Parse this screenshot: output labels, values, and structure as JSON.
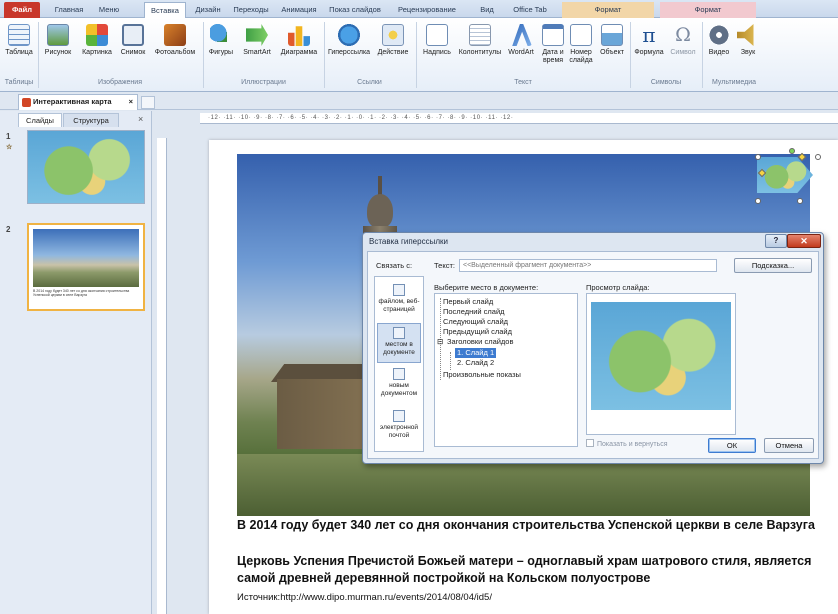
{
  "ribbon_tabs": [
    {
      "label": "Файл"
    },
    {
      "label": "Главная"
    },
    {
      "label": "Меню"
    },
    {
      "label": "Вставка"
    },
    {
      "label": "Дизайн"
    },
    {
      "label": "Переходы"
    },
    {
      "label": "Анимация"
    },
    {
      "label": "Показ слайдов"
    },
    {
      "label": "Рецензирование"
    },
    {
      "label": "Вид"
    },
    {
      "label": "Office Tab"
    },
    {
      "label": "Формат"
    },
    {
      "label": "Формат"
    }
  ],
  "ribbon_buttons": [
    {
      "label": "Таблица",
      "icon": "table-icon"
    },
    {
      "label": "Рисунок",
      "icon": "picture-icon"
    },
    {
      "label": "Картинка",
      "icon": "clipart-icon"
    },
    {
      "label": "Снимок",
      "icon": "screenshot-icon"
    },
    {
      "label": "Фотоальбом",
      "icon": "photo-album-icon"
    },
    {
      "label": "Фигуры",
      "icon": "shapes-icon"
    },
    {
      "label": "SmartArt",
      "icon": "smartart-icon"
    },
    {
      "label": "Диаграмма",
      "icon": "chart-icon"
    },
    {
      "label": "Гиперссылка",
      "icon": "hyperlink-icon"
    },
    {
      "label": "Действие",
      "icon": "action-icon"
    },
    {
      "label": "Надпись",
      "icon": "textbox-icon"
    },
    {
      "label": "Колонтитулы",
      "icon": "header-footer-icon"
    },
    {
      "label": "WordArt",
      "icon": "wordart-icon"
    },
    {
      "label": "Дата и время",
      "icon": "date-time-icon"
    },
    {
      "label": "Номер слайда",
      "icon": "slide-number-icon"
    },
    {
      "label": "Объект",
      "icon": "object-icon"
    },
    {
      "label": "Формула",
      "icon": "equation-icon"
    },
    {
      "label": "Символ",
      "icon": "symbol-icon"
    },
    {
      "label": "Видео",
      "icon": "video-icon"
    },
    {
      "label": "Звук",
      "icon": "audio-icon"
    }
  ],
  "ribbon_groups": [
    {
      "label": "Таблицы"
    },
    {
      "label": "Изображения"
    },
    {
      "label": "Иллюстрации"
    },
    {
      "label": "Ссылки"
    },
    {
      "label": "Текст"
    },
    {
      "label": "Символы"
    },
    {
      "label": "Мультимедиа"
    }
  ],
  "document_tab": {
    "label": "Интерактивная карта",
    "close": "×"
  },
  "left_panel": {
    "tabs": [
      {
        "label": "Слайды"
      },
      {
        "label": "Структура"
      }
    ],
    "close": "×",
    "thumbnails": [
      {
        "number": "1"
      },
      {
        "number": "2"
      }
    ],
    "thumb2_caption": "В 2014 году будет 340 лет со дня окончания строительства Успенской церкви в селе Варзуга"
  },
  "ruler": {
    "horizontal": "·12· ·11· ·10· ·9· ·8· ·7· ·6· ·5· ·4· ·3· ·2· ·1· ·0· ·1· ·2· ·3· ·4· ·5· ·6· ·7· ·8· ·9· ·10· ·11· ·12·"
  },
  "slide": {
    "line1": "В 2014 году будет 340 лет со дня окончания строительства Успенской церкви в селе Варзуга",
    "line2": "Церковь Успения Пречистой Божьей матери – одноглавый храм шатрового стиля, является самой древней деревянной постройкой на Кольском полуострове",
    "source": "Источник:http://www.dipo.murman.ru/events/2014/08/04/id5/"
  },
  "dialog": {
    "title": "Вставка гиперссылки",
    "help": "?",
    "close": "✕",
    "link_to_label": "Связать с:",
    "link_options": [
      {
        "label": "файлом, веб-страницей",
        "icon": "web-page-icon"
      },
      {
        "label": "местом в документе",
        "icon": "place-in-document-icon"
      },
      {
        "label": "новым документом",
        "icon": "new-document-icon"
      },
      {
        "label": "электронной почтой",
        "icon": "email-icon"
      }
    ],
    "text_label": "Текст:",
    "text_value": "<<Выделенный фрагмент документа>>",
    "screentip_button": "Подсказка...",
    "place_label": "Выберите место в документе:",
    "tree": {
      "first": "Первый слайд",
      "last": "Последний слайд",
      "next": "Следующий слайд",
      "prev": "Предыдущий слайд",
      "headers": "Заголовки слайдов",
      "slide1": "1. Слайд 1",
      "slide2": "2. Слайд 2",
      "custom": "Произвольные показы"
    },
    "preview_label": "Просмотр слайда:",
    "show_and_return": "Показать и вернуться",
    "ok": "ОК",
    "cancel": "Отмена"
  },
  "colors": {
    "file_tab": "#c8372b",
    "selection": "#3d7bd0",
    "thumb_selected": "#f0b343"
  }
}
